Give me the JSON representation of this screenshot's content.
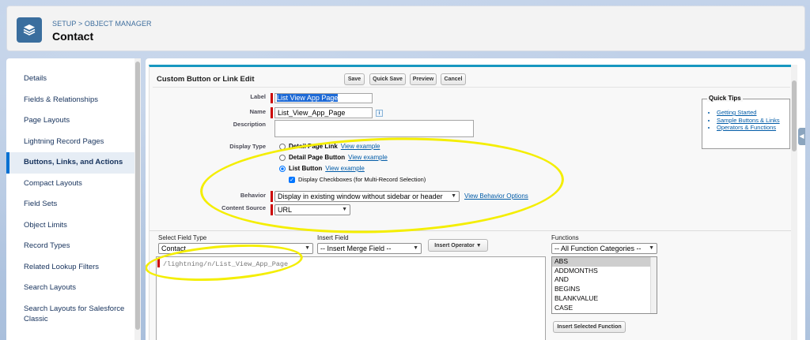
{
  "header": {
    "breadcrumb": "SETUP > OBJECT MANAGER",
    "title": "Contact",
    "icon": "layers-icon"
  },
  "sidebar": {
    "items": [
      {
        "label": "Details"
      },
      {
        "label": "Fields & Relationships"
      },
      {
        "label": "Page Layouts"
      },
      {
        "label": "Lightning Record Pages"
      },
      {
        "label": "Buttons, Links, and Actions"
      },
      {
        "label": "Compact Layouts"
      },
      {
        "label": "Field Sets"
      },
      {
        "label": "Object Limits"
      },
      {
        "label": "Record Types"
      },
      {
        "label": "Related Lookup Filters"
      },
      {
        "label": "Search Layouts"
      },
      {
        "label": "Search Layouts for Salesforce Classic"
      }
    ],
    "active_index": 4
  },
  "panel": {
    "title": "Custom Button or Link Edit",
    "buttons": {
      "save": "Save",
      "quick_save": "Quick Save",
      "preview": "Preview",
      "cancel": "Cancel"
    }
  },
  "form": {
    "label_label": "Label",
    "label_value": "List View App Page",
    "name_label": "Name",
    "name_value": "List_View_App_Page",
    "info_icon": "i",
    "description_label": "Description",
    "description_value": "",
    "display_type_label": "Display Type",
    "display_types": [
      {
        "label": "Detail Page Link",
        "link": "View example",
        "selected": false
      },
      {
        "label": "Detail Page Button",
        "link": "View example",
        "selected": false
      },
      {
        "label": "List Button",
        "link": "View example",
        "selected": true
      }
    ],
    "display_checkboxes_label": "Display Checkboxes (for Multi-Record Selection)",
    "display_checkboxes_checked": true,
    "behavior_label": "Behavior",
    "behavior_value": "Display in existing window without sidebar or header",
    "behavior_link": "View Behavior Options",
    "content_source_label": "Content Source",
    "content_source_value": "URL"
  },
  "quick_tips": {
    "title": "Quick Tips",
    "links": [
      "Getting Started",
      "Sample Buttons & Links",
      "Operators & Functions"
    ]
  },
  "formula": {
    "select_field_type_label": "Select Field Type",
    "select_field_type_value": "Contact",
    "insert_field_label": "Insert Field",
    "insert_field_value": "-- Insert Merge Field --",
    "insert_operator_label": "Insert Operator",
    "functions_label": "Functions",
    "functions_category_value": "-- All Function Categories --",
    "functions": [
      "ABS",
      "ADDMONTHS",
      "AND",
      "BEGINS",
      "BLANKVALUE",
      "CASE"
    ],
    "functions_selected_index": 0,
    "insert_function_label": "Insert Selected Function",
    "editor_text": "/lightning/n/List_View_App_Page"
  },
  "colors": {
    "accent": "#0070d2",
    "highlight": "#f4ee00",
    "required": "#cc0000"
  }
}
